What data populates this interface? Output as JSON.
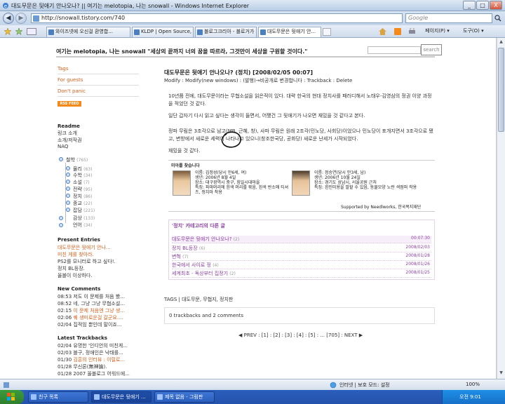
{
  "window": {
    "title": "대도무문은 뒷애기 안나오나? || 여기는 melotopia, 나는 snowall - Windows Internet Explorer",
    "min": "_",
    "max": "□",
    "close": "X"
  },
  "address": {
    "url": "http://snowall.tistory.com/740",
    "search_placeholder": "Google",
    "back": "◀",
    "forward": "▶"
  },
  "tabs": [
    {
      "label": "와이즈넷에 오신걸 환영합..."
    },
    {
      "label": "KLDP | Open Source, Gee..."
    },
    {
      "label": "블로그크리아 - 블로거가 ..."
    },
    {
      "label": "대도무문은 뒷애기 안..."
    }
  ],
  "toolbar": {
    "page": "페이지(P) ▾",
    "tools": "도구(O) ▾"
  },
  "blog": {
    "header": "여기는 melotopia, 나는 snowall \"세상의 끝까지 너의 꿈을 따르라, 그것만이 세상을 구원할 것이다.\"",
    "search_button": "search"
  },
  "sidebar": {
    "links": [
      "Tags",
      "For guests",
      "Don't panic"
    ],
    "rss": "RSS FEED",
    "readme_head": "Readme",
    "readme": [
      "링크 소개",
      "소개/저작권",
      "NAQ"
    ],
    "categories": [
      {
        "label": "철학",
        "count": "(765)",
        "root": true
      },
      {
        "label": "물리",
        "count": "(63)"
      },
      {
        "label": "수학",
        "count": "(34)"
      },
      {
        "label": "소설",
        "count": "(7)"
      },
      {
        "label": "전략",
        "count": "(95)"
      },
      {
        "label": "정치",
        "count": "(86)"
      },
      {
        "label": "종교",
        "count": "(22)"
      },
      {
        "label": "잡담",
        "count": "(221)"
      },
      {
        "label": "감상",
        "count": "(133)"
      },
      {
        "label": "언어",
        "count": "(34)"
      }
    ],
    "present_head": "Present Entries",
    "present": [
      {
        "text": "대도무문은 뒷애기 안나...",
        "color": "orange"
      },
      {
        "text": "미친 게를 찾아라.",
        "color": "orange"
      },
      {
        "text": "PS2를 모니터로 하고 싶다!.",
        "color": "dark"
      },
      {
        "text": "정치 BL등장.",
        "color": "dark"
      },
      {
        "text": "올블이 이상하다.",
        "color": "dark"
      }
    ],
    "comments_head": "New Comments",
    "comments": [
      {
        "time": "08:53",
        "text": "저도 이 문제를 처음 봤...",
        "color": "dark"
      },
      {
        "time": "08:52",
        "text": "네, 그냥 그냥 무협소설...",
        "color": "dark"
      },
      {
        "time": "02:15",
        "text": "이 문제 처음엔 그냥 생...",
        "color": "orange"
      },
      {
        "time": "02:06",
        "text": "퀘 생미로운걸 갈군요....",
        "color": "orange"
      },
      {
        "time": "02/04",
        "text": "집적임 뿐인데 말이죠...",
        "color": "dark"
      }
    ],
    "trackbacks_head": "Latest Trackbacks",
    "trackbacks": [
      {
        "time": "02/04",
        "text": "유명한 '인디언의 미친게...",
        "color": "dark"
      },
      {
        "time": "02/03",
        "text": "블구, 정애인은 낙태를...",
        "color": "dark"
      },
      {
        "time": "01/30",
        "text": "김훈의 인터뷰 : 이럴로...",
        "color": "orange"
      },
      {
        "time": "01/28",
        "text": "무신론(無神論).",
        "color": "dark"
      },
      {
        "time": "01/28",
        "text": "2007 올블로그 어워드에...",
        "color": "dark"
      }
    ]
  },
  "post": {
    "title": "대도무문은 뒷애기 안나오나? (정치) [2008/02/05 00:07]",
    "meta": "Modify : Modify(new windows) : (발행)→비공개로 변경합니다 : Trackback : Delete",
    "p1": "10년쯤 전에, 대도무문이라는 무협소설을 읽은적이 있다. 대략 한국의 현대 정치사를 패러디해서 노태우-김영삼의 정권 이양 과정을 적었던 것 같다.",
    "p2": "일단 갑자기 다시 읽고 싶다는 생각이 들면서, 어쨌건 그 뒷애기가 나오면 재밌을 것 같다고 본다.",
    "p3": "정파 무림은 3조각으로 남고(MB, 근혜, 창), 사파 무림은 원래 2조각(민노당, 사회당)이었으나 민노당이 포개지면서 3조각으로 됐고, 변방에서 새로운 세력이 나타나고 있으니(창조한국당, 공화당) 새로운 난세가 시작되었다.",
    "p4": "재밌을 것 같다.",
    "profile_head": "미아를 찾습니다",
    "profile1": [
      "이름: 김정성(당시 만6세, 여)",
      "생년: 2006년 8월 4일",
      "장소: 대구광역시 중구, 힘일시대마을",
      "특징: 파마머리에 흰색 머리를 묶음, 흰색 반소매 티셔츠, 청치마 착용"
    ],
    "profile2": [
      "이름: 정승연(당시 만3세, 남)",
      "생년: 2006년 10월 24일",
      "장소: 경기도 성남시, 서울공원 근처",
      "특징: 흰민미용을 발할 수 있음, 동물모양 노란 색점퍼 착용"
    ],
    "supported": "Supported by Needlworks, 한국복지재단",
    "related_head": "'정치' 카테고리의 다른 글",
    "related": [
      {
        "title": "대도무문은 뒷애기 안나오나?",
        "count": "(2)",
        "date": "00:07:30"
      },
      {
        "title": "정치 BL등장",
        "count": "(6)",
        "date": "2008/02/03"
      },
      {
        "title": "변혁",
        "count": "(7)",
        "date": "2008/01/28"
      },
      {
        "title": "한국에서 사이로 정",
        "count": "(4)",
        "date": "2008/01/26"
      },
      {
        "title": "세계최초 - 독상부터 집정기",
        "count": "(2)",
        "date": "2008/01/25"
      }
    ],
    "tags": "TAGS | 대도무문, 무협지, 정치판",
    "tracks": "0 trackbacks and 2 comments",
    "pager": "◀ PREV : [1] : [2] : [3] : [4] : [5] : ... [705] : NEXT ▶"
  },
  "status": {
    "zone": "인터넷 | 보호 모드: 설정",
    "zoom": "100%"
  },
  "taskbar": {
    "tasks": [
      "친구 목록",
      "대도무문은 뒷애기 ...",
      "제목 없음 - 그림판"
    ],
    "clock": "오전 9:01"
  }
}
